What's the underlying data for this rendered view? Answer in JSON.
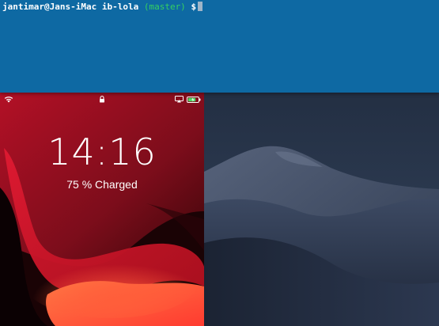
{
  "terminal": {
    "user_host": "jantimar@Jans-iMac",
    "directory": "ib-lola",
    "branch": "(master)",
    "prompt_symbol": "$"
  },
  "phone": {
    "time": "14:16",
    "charge_status": "75 % Charged",
    "battery_level_percent": 75,
    "status_icons": [
      "wifi-icon",
      "lock-icon",
      "airplay-icon",
      "battery-icon"
    ],
    "colors": {
      "wallpaper_dark": "#2a0508",
      "wallpaper_red": "#c4152b",
      "wallpaper_orange": "#ff6a3a",
      "battery_fill": "#4cd964"
    }
  },
  "desktop": {
    "wallpaper": "mojave-dark-dunes"
  },
  "colors": {
    "terminal_bg": "#0e69a3",
    "git_branch": "#35d061"
  }
}
